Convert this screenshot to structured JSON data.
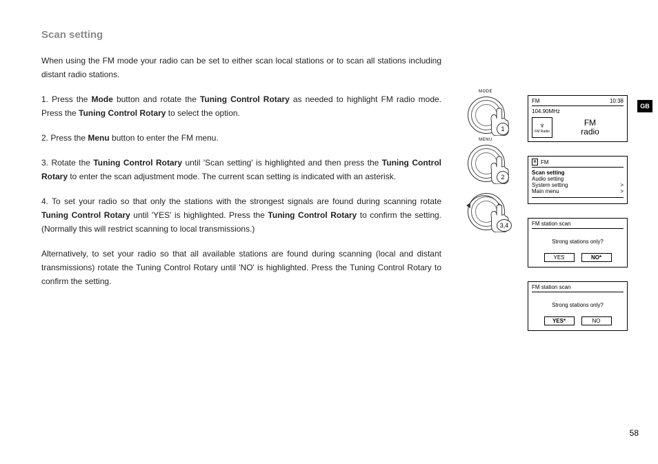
{
  "heading": "Scan setting",
  "intro": "When using the FM mode your radio can be set to either scan local stations or to scan all stations including distant radio stations.",
  "steps": {
    "s1a": "1. Press the ",
    "s1b": "Mode",
    "s1c": " button and rotate the ",
    "s1d": "Tuning Control Rotary",
    "s1e": " as needed to highlight FM radio mode. Press the ",
    "s1f": "Tuning Control Rotary",
    "s1g": " to select the option.",
    "s2a": "2. Press the ",
    "s2b": "Menu",
    "s2c": " button to enter the FM menu.",
    "s3a": "3. Rotate the ",
    "s3b": "Tuning Control Rotary",
    "s3c": " until 'Scan setting' is highlighted and then press the ",
    "s3d": "Tuning Control Rotary",
    "s3e": " to enter the scan adjustment mode. The current scan setting is indicated with an asterisk.",
    "s4a": "4. To set your radio so that only the stations with the strongest signals are found during scanning rotate ",
    "s4b": "Tuning Control Rotary",
    "s4c": " until 'YES' is highlighted. Press the ",
    "s4d": "Tuning Control Rotary",
    "s4e": " to confirm the setting. (Normally this will restrict scanning to local transmissions.)"
  },
  "alt": "Alternatively, to set your radio so that all available stations are found during scanning (local and distant transmissions) rotate the Tuning Control Rotary until 'NO' is highlighted. Press the Tuning Control Rotary to confirm the setting.",
  "page_number": "58",
  "lang_tab": "GB",
  "dials": {
    "d1_label": "MODE",
    "d1_badge": "1",
    "d2_label": "MENU",
    "d2_badge": "2",
    "d3_badge": "3,4"
  },
  "screen1": {
    "band": "FM",
    "time": "10:38",
    "freq": "104.90MHz",
    "icon_caption": "FM Radio",
    "title_line1": "FM",
    "title_line2": "radio"
  },
  "screen2": {
    "header": "FM",
    "item1": "Scan setting",
    "item2": "Audio setting",
    "item3": "System setting",
    "item4": "Main menu",
    "chev": ">"
  },
  "screen3": {
    "header": "FM station scan",
    "prompt": "Strong stations only?",
    "yes": "YES",
    "no": "NO*"
  },
  "screen4": {
    "header": "FM station scan",
    "prompt": "Strong stations only?",
    "yes": "YES*",
    "no": "NO"
  }
}
